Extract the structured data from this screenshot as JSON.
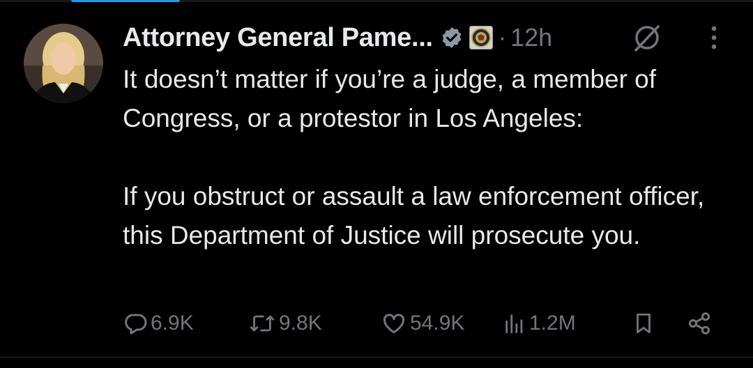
{
  "colors": {
    "background": "#000000",
    "text_primary": "#e7e9ea",
    "text_secondary": "#71767b",
    "verified_badge": "#8b98a5"
  },
  "post": {
    "author_name": "Attorney General Pame...",
    "separator": "·",
    "timestamp": "12h",
    "badge_icon": "verified-badge-icon",
    "affiliation_icon": "doj-seal-icon",
    "paragraphs": [
      "It doesn’t matter if you’re a judge, a member of Congress, or a protestor in Los Angeles:",
      "If you obstruct or assault a law enforcement officer, this Department of Justice will prosecute you."
    ]
  },
  "actions": {
    "replies": "6.9K",
    "reposts": "9.8K",
    "likes": "54.9K",
    "views": "1.2M"
  }
}
